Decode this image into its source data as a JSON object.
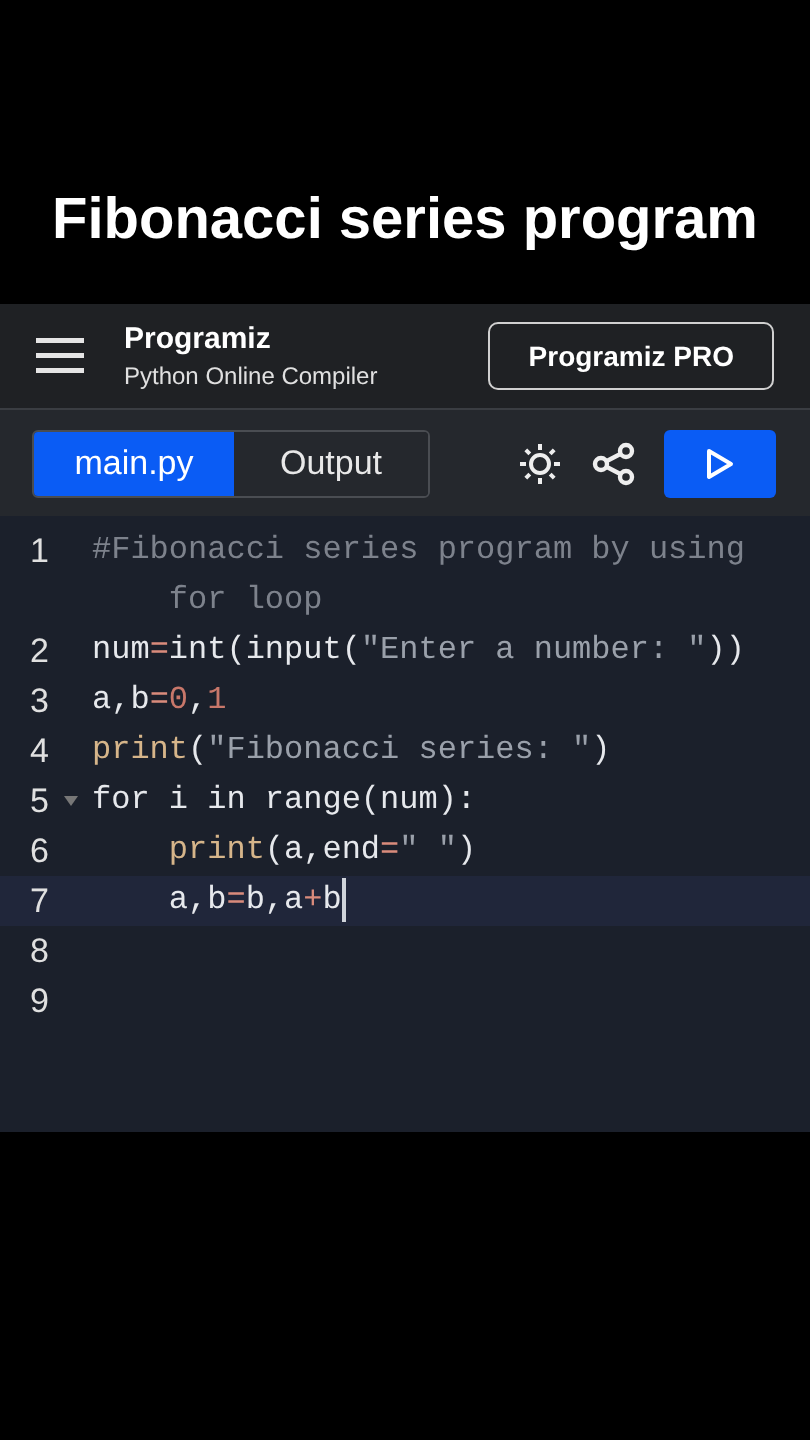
{
  "title": "Fibonacci series program",
  "header": {
    "logo": "Programiz",
    "subtitle": "Python Online Compiler",
    "pro_button": "Programiz PRO"
  },
  "tabs": [
    {
      "label": "main.py",
      "selected": true
    },
    {
      "label": "Output",
      "selected": false
    }
  ],
  "editor": {
    "lines": [
      {
        "number": "1",
        "foldable": false,
        "active": false,
        "tokens": [
          {
            "kind": "comment",
            "text": "#Fibonacci series program by using for loop"
          }
        ]
      },
      {
        "number": "2",
        "foldable": false,
        "active": false,
        "tokens": [
          {
            "kind": "name",
            "text": "num"
          },
          {
            "kind": "op",
            "text": "="
          },
          {
            "kind": "name",
            "text": "int(input("
          },
          {
            "kind": "string",
            "text": "\"Enter a number: \""
          },
          {
            "kind": "name",
            "text": "))"
          }
        ]
      },
      {
        "number": "3",
        "foldable": false,
        "active": false,
        "tokens": [
          {
            "kind": "name",
            "text": "a,b"
          },
          {
            "kind": "op",
            "text": "="
          },
          {
            "kind": "number",
            "text": "0"
          },
          {
            "kind": "name",
            "text": ","
          },
          {
            "kind": "number",
            "text": "1"
          }
        ]
      },
      {
        "number": "4",
        "foldable": false,
        "active": false,
        "tokens": [
          {
            "kind": "builtin",
            "text": "print"
          },
          {
            "kind": "name",
            "text": "("
          },
          {
            "kind": "string",
            "text": "\"Fibonacci series: \""
          },
          {
            "kind": "name",
            "text": ")"
          }
        ]
      },
      {
        "number": "5",
        "foldable": true,
        "active": false,
        "tokens": [
          {
            "kind": "name",
            "text": "for i in range(num):"
          }
        ]
      },
      {
        "number": "6",
        "foldable": false,
        "active": false,
        "tokens": [
          {
            "kind": "builtin",
            "text": "    print"
          },
          {
            "kind": "name",
            "text": "(a,end"
          },
          {
            "kind": "op",
            "text": "="
          },
          {
            "kind": "string",
            "text": "\" \""
          },
          {
            "kind": "name",
            "text": ")"
          }
        ]
      },
      {
        "number": "7",
        "foldable": false,
        "active": true,
        "tokens": [
          {
            "kind": "name",
            "text": "    a,b"
          },
          {
            "kind": "op",
            "text": "="
          },
          {
            "kind": "name",
            "text": "b,a"
          },
          {
            "kind": "op",
            "text": "+"
          },
          {
            "kind": "name",
            "text": "b"
          }
        ]
      },
      {
        "number": "8",
        "foldable": false,
        "active": false
      },
      {
        "number": "9",
        "foldable": false,
        "active": false
      }
    ]
  }
}
